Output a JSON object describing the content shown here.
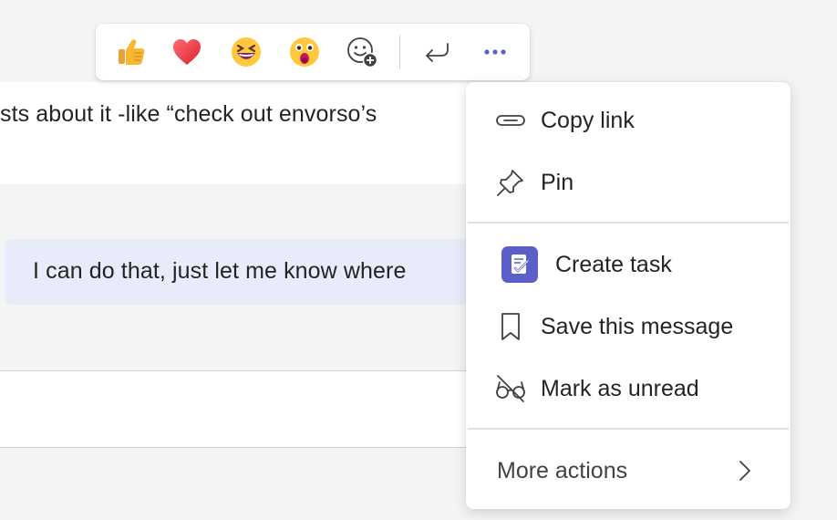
{
  "chat": {
    "message_text": "sts about it -like “check out envorso’s",
    "reply_text": "I can do that, just let me know where"
  },
  "reaction_bar": {
    "reactions": [
      "like",
      "heart",
      "laugh",
      "surprised"
    ],
    "add_reaction": "emoji-plus-icon",
    "reply": "reply-icon",
    "more": "more-options-icon"
  },
  "menu": {
    "copy_link": "Copy link",
    "pin": "Pin",
    "create_task": "Create task",
    "save_message": "Save this message",
    "mark_unread": "Mark as unread",
    "more_actions": "More actions"
  },
  "colors": {
    "accent": "#5b5fc7",
    "bubble": "#e8ebfa",
    "background": "#f4f4f4"
  }
}
